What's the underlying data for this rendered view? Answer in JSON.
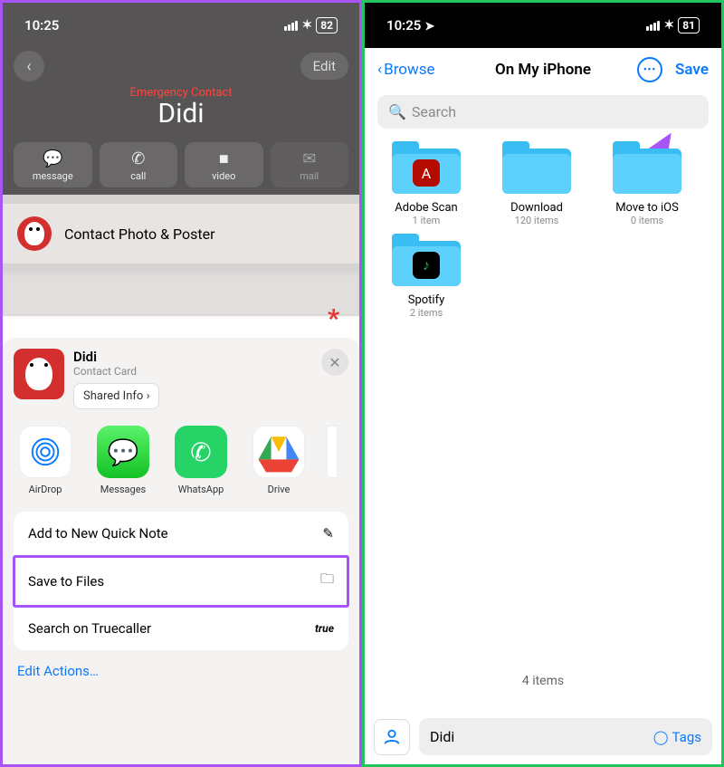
{
  "left": {
    "status": {
      "time": "10:25",
      "battery": "82"
    },
    "nav": {
      "edit": "Edit"
    },
    "contact": {
      "emergency": "Emergency Contact",
      "name": "Didi",
      "actions": {
        "message": "message",
        "call": "call",
        "video": "video",
        "mail": "mail"
      }
    },
    "photoRow": "Contact Photo & Poster",
    "share": {
      "title": "Didi",
      "subtitle": "Contact Card",
      "sharedInfo": "Shared Info",
      "apps": {
        "airdrop": "AirDrop",
        "messages": "Messages",
        "whatsapp": "WhatsApp",
        "drive": "Drive"
      },
      "actions": {
        "quickNote": "Add to New Quick Note",
        "saveFiles": "Save to Files",
        "truecaller": "Search on Truecaller"
      },
      "editActions": "Edit Actions…"
    }
  },
  "right": {
    "status": {
      "time": "10:25",
      "battery": "81"
    },
    "nav": {
      "browse": "Browse",
      "title": "On My iPhone",
      "save": "Save"
    },
    "searchPlaceholder": "Search",
    "folders": [
      {
        "name": "Adobe Scan",
        "meta": "1 item",
        "app": "adobe"
      },
      {
        "name": "Download",
        "meta": "120 items",
        "app": ""
      },
      {
        "name": "Move to iOS",
        "meta": "0 items",
        "app": ""
      },
      {
        "name": "Spotify",
        "meta": "2 items",
        "app": "spotify"
      }
    ],
    "itemCount": "4 items",
    "footer": {
      "filename": "Didi",
      "tags": "Tags"
    }
  }
}
